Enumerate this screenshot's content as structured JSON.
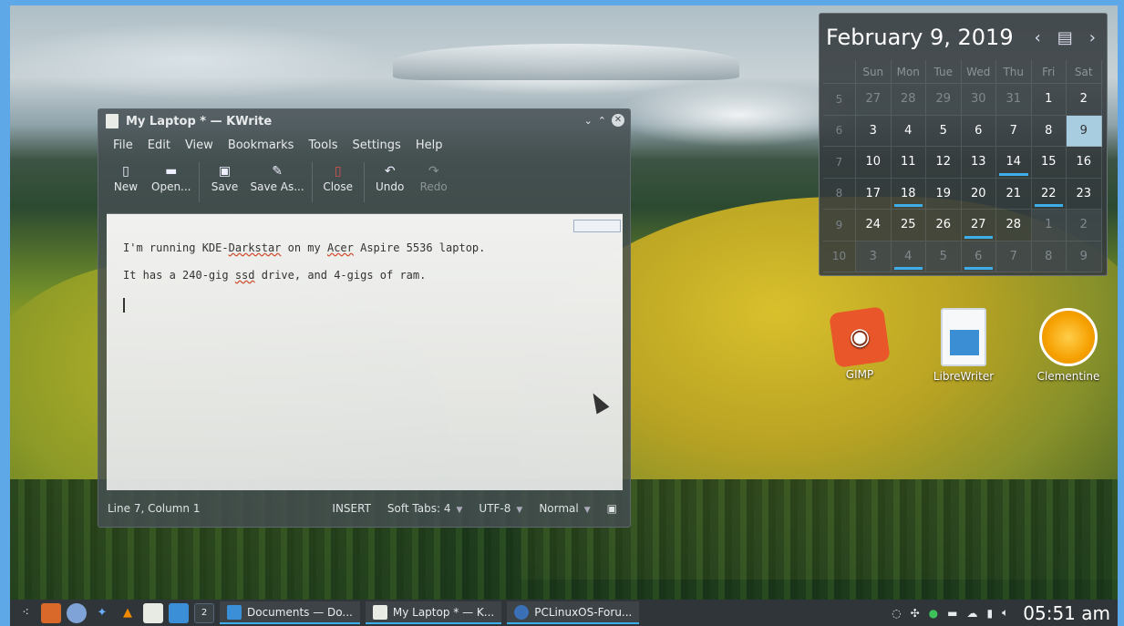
{
  "kwrite": {
    "title": "My Laptop * — KWrite",
    "menu": [
      "File",
      "Edit",
      "View",
      "Bookmarks",
      "Tools",
      "Settings",
      "Help"
    ],
    "toolbar": {
      "new": "New",
      "open": "Open...",
      "save": "Save",
      "save_as": "Save As...",
      "close": "Close",
      "undo": "Undo",
      "redo": "Redo"
    },
    "editor": {
      "line1_a": "I'm running KDE-",
      "line1_b": "Darkstar",
      "line1_c": " on my ",
      "line1_d": "Acer",
      "line1_e": " Aspire 5536 laptop.",
      "line2_a": "It has a 240-gig ",
      "line2_b": "ssd",
      "line2_c": " drive, and 4-gigs of ram."
    },
    "status": {
      "position": "Line 7, Column 1",
      "mode": "INSERT",
      "tabs": "Soft Tabs: 4",
      "encoding": "UTF-8",
      "syntax": "Normal"
    }
  },
  "calendar": {
    "title": "February 9, 2019",
    "weekdays": [
      "Sun",
      "Mon",
      "Tue",
      "Wed",
      "Thu",
      "Fri",
      "Sat"
    ],
    "weeks": [
      {
        "wk": "5",
        "days": [
          "27",
          "28",
          "29",
          "30",
          "31",
          "1",
          "2"
        ]
      },
      {
        "wk": "6",
        "days": [
          "3",
          "4",
          "5",
          "6",
          "7",
          "8",
          "9"
        ]
      },
      {
        "wk": "7",
        "days": [
          "10",
          "11",
          "12",
          "13",
          "14",
          "15",
          "16"
        ]
      },
      {
        "wk": "8",
        "days": [
          "17",
          "18",
          "19",
          "20",
          "21",
          "22",
          "23"
        ]
      },
      {
        "wk": "9",
        "days": [
          "24",
          "25",
          "26",
          "27",
          "28",
          "1",
          "2"
        ]
      },
      {
        "wk": "10",
        "days": [
          "3",
          "4",
          "5",
          "6",
          "7",
          "8",
          "9"
        ]
      }
    ]
  },
  "desktop_icons": {
    "gimp": "GIMP",
    "writer": "LibreWriter",
    "clementine": "Clementine"
  },
  "taskbar": {
    "pager_number": "2",
    "tasks": [
      "Documents — Do...",
      "My Laptop * — K...",
      "PCLinuxOS-Foru..."
    ],
    "clock": "05:51 am"
  },
  "colors": {
    "accent": "#3daee9",
    "today_highlight": "#a9cde0",
    "panel": "#2f3538"
  }
}
